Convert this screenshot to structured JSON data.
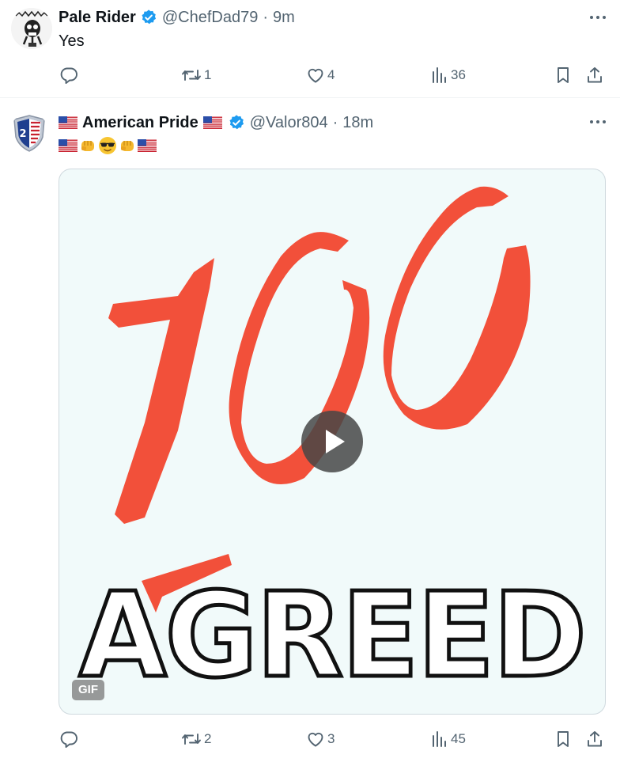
{
  "tweets": [
    {
      "display_name": "Pale Rider",
      "handle": "@ChefDad79",
      "separator": "·",
      "time": "9m",
      "text": "Yes",
      "verified": true,
      "avatar_icon": "skull-cartoon-avatar",
      "stats": {
        "replies": "",
        "reposts": "1",
        "likes": "4",
        "views": "36"
      }
    },
    {
      "display_name": "American Pride",
      "handle": "@Valor804",
      "separator": "·",
      "time": "18m",
      "text_emojis": [
        "us-flag",
        "oncoming-fist",
        "sunglasses-face",
        "oncoming-fist",
        "us-flag"
      ],
      "name_emojis": [
        "us-flag",
        "us-flag"
      ],
      "verified": true,
      "avatar_icon": "patriotic-shield-avatar",
      "media": {
        "type": "gif",
        "badge": "GIF",
        "image_text": [
          "100",
          "AGREED"
        ]
      },
      "stats": {
        "replies": "",
        "reposts": "2",
        "likes": "3",
        "views": "45"
      }
    }
  ],
  "colors": {
    "text_primary": "#0f1419",
    "text_secondary": "#536471",
    "verified_blue": "#1d9bf0",
    "hundred_red": "#f2503a",
    "media_bg": "#f1fafa",
    "divider": "#eff3f4"
  }
}
